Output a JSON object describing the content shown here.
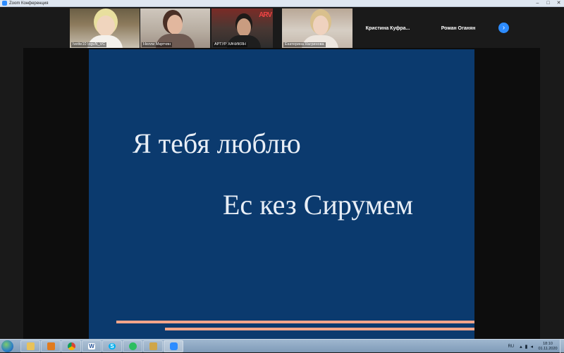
{
  "window": {
    "title": "Zoom Конференция",
    "controls": {
      "minimize": "–",
      "maximize": "□",
      "close": "✕"
    }
  },
  "gallery": {
    "participants": [
      {
        "name": "Ivette10 loguN_VC",
        "video": true
      },
      {
        "name": "Нелли Мкртчян",
        "video": true
      },
      {
        "name": "АРТУР ХАЧИКЯН",
        "video": true,
        "poster_text": "ARV"
      },
      {
        "name": "Екатерина Нагринова",
        "video": true
      },
      {
        "name": "Кристина  Куфра...",
        "video": false
      },
      {
        "name": "Роман Оганян",
        "video": false
      }
    ],
    "next_icon": "chevron-right-icon",
    "next_glyph": "›"
  },
  "slide": {
    "line1": "Я тебя люблю",
    "line2": "Ес кез Сирумем",
    "background": "#0b3a6e",
    "accent": "#f2a58a"
  },
  "taskbar": {
    "apps": [
      {
        "name": "media-player-icon",
        "color": "#e07b1f"
      },
      {
        "name": "file-explorer-icon",
        "color": "#e8c25a"
      },
      {
        "name": "media-player-icon",
        "color": "#e07b1f"
      },
      {
        "name": "chrome-icon",
        "color": "#db4437"
      },
      {
        "name": "word-icon",
        "color": "#2b579a",
        "glyph": "W"
      },
      {
        "name": "skype-icon",
        "color": "#00aff0",
        "glyph": "S"
      },
      {
        "name": "evernote-icon",
        "color": "#2dbe60"
      },
      {
        "name": "paint-icon",
        "color": "#cfa64a"
      },
      {
        "name": "zoom-icon",
        "color": "#2d8cff"
      }
    ],
    "language": "RU",
    "time": "18:10",
    "date": "01.11.2020"
  }
}
